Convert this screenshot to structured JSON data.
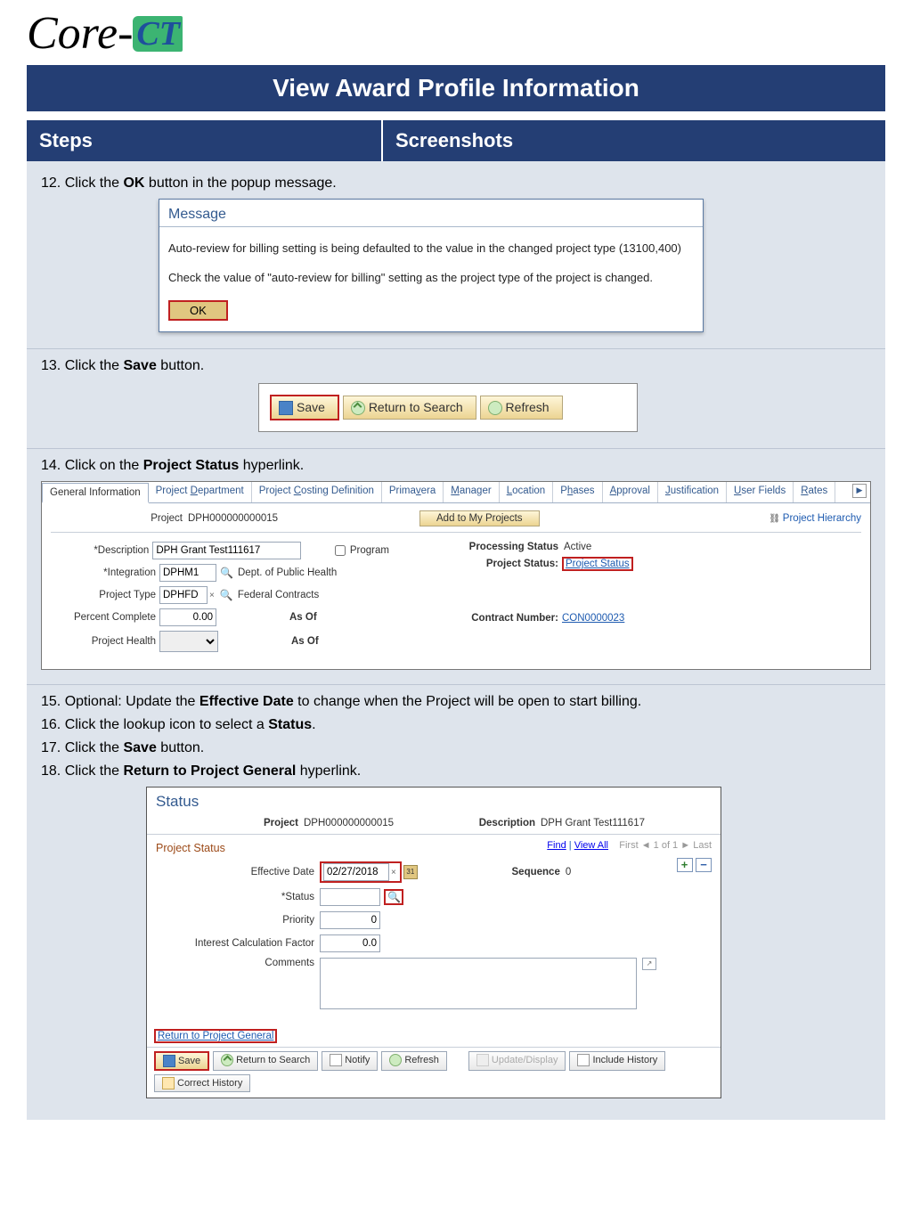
{
  "logo": {
    "core": "Core-",
    "ct": "CT"
  },
  "page_title": "View Award Profile Information",
  "headers": {
    "steps": "Steps",
    "screenshots": "Screenshots"
  },
  "step12": {
    "prefix": "12. Click the ",
    "bold": "OK",
    "suffix": " button in the popup message."
  },
  "popup": {
    "title": "Message",
    "line1": "Auto-review for billing setting is being defaulted to the value in the changed project type (13100,400)",
    "line2": "Check the value of \"auto-review for billing\" setting as the project type of the project is changed.",
    "ok": "OK"
  },
  "step13": {
    "prefix": "13. Click the ",
    "bold": "Save",
    "suffix": " button."
  },
  "toolbar": {
    "save": "Save",
    "return": "Return to Search",
    "refresh": "Refresh"
  },
  "step14": {
    "prefix": "14. Click on the ",
    "bold": "Project Status",
    "suffix": " hyperlink."
  },
  "tabs": {
    "gi": "General Information",
    "pd": "Project Department",
    "pcd": "Project Costing Definition",
    "prim": "Primavera",
    "mgr": "Manager",
    "loc": "Location",
    "ph": "Phases",
    "appr": "Approval",
    "just": "Justification",
    "uf": "User Fields",
    "rates": "Rates"
  },
  "gi": {
    "project_lbl": "Project",
    "project_val": "DPH000000000015",
    "add_my": "Add to My Projects",
    "proj_hier": "Project Hierarchy",
    "desc_lbl": "*Description",
    "desc_val": "DPH Grant Test111617",
    "program": "Program",
    "integ_lbl": "*Integration",
    "integ_val": "DPHM1",
    "integ_txt": "Dept. of Public Health",
    "ptype_lbl": "Project Type",
    "ptype_val": "DPHFD",
    "ptype_txt": "Federal Contracts",
    "pct_lbl": "Percent Complete",
    "pct_val": "0.00",
    "asof": "As Of",
    "phealth_lbl": "Project Health",
    "proc_lbl": "Processing Status",
    "proc_val": "Active",
    "pstat_lbl": "Project Status:",
    "pstat_link": "Project Status",
    "cnum_lbl": "Contract Number:",
    "cnum_link": "CON0000023"
  },
  "step15": {
    "prefix": "15. Optional: Update the ",
    "bold": "Effective Date",
    "suffix": " to change when the Project will be open to start billing."
  },
  "step16": {
    "prefix": "16. Click the lookup icon to select a ",
    "bold": "Status",
    "suffix": "."
  },
  "step17": {
    "prefix": "17. Click the ",
    "bold": "Save",
    "suffix": " button."
  },
  "step18": {
    "prefix": "18. Click the ",
    "bold": "Return to Project General",
    "suffix": " hyperlink."
  },
  "status": {
    "title": "Status",
    "project_lbl": "Project",
    "project_val": "DPH000000000015",
    "desc_lbl": "Description",
    "desc_val": "DPH Grant Test111617",
    "section": "Project Status",
    "find": "Find",
    "viewall": "View All",
    "first": "First",
    "pager": "1 of 1",
    "last": "Last",
    "eff_lbl": "Effective Date",
    "eff_val": "02/27/2018",
    "seq_lbl": "Sequence",
    "seq_val": "0",
    "stat_lbl": "*Status",
    "prio_lbl": "Priority",
    "prio_val": "0",
    "icf_lbl": "Interest Calculation Factor",
    "icf_val": "0.0",
    "comments_lbl": "Comments",
    "return_link": "Return to Project General",
    "footer": {
      "save": "Save",
      "rts": "Return to Search",
      "notify": "Notify",
      "refresh": "Refresh",
      "upd": "Update/Display",
      "inc": "Include History",
      "corr": "Correct History"
    }
  }
}
